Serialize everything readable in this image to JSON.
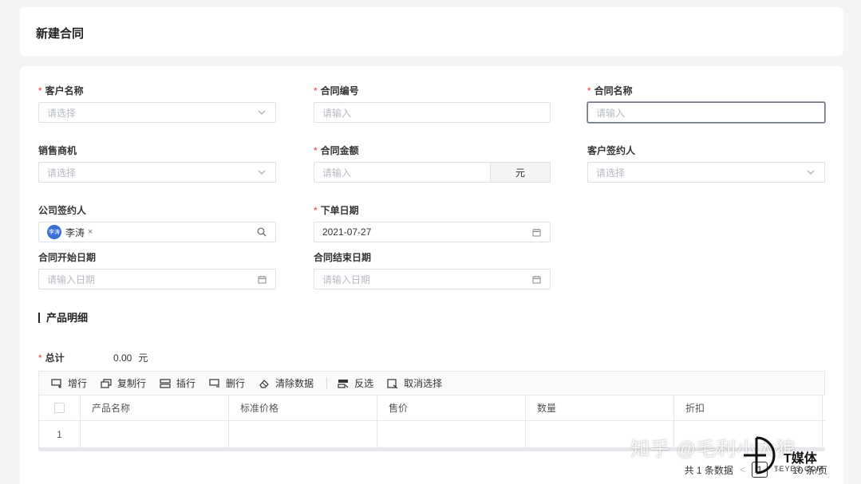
{
  "header": {
    "title": "新建合同"
  },
  "form": {
    "customer_name": {
      "label": "客户名称",
      "required": true,
      "placeholder": "请选择"
    },
    "contract_no": {
      "label": "合同编号",
      "required": true,
      "placeholder": "请输入"
    },
    "contract_name": {
      "label": "合同名称",
      "required": true,
      "placeholder": "请输入"
    },
    "sales_opportunity": {
      "label": "销售商机",
      "required": false,
      "placeholder": "请选择"
    },
    "contract_amount": {
      "label": "合同金额",
      "required": true,
      "placeholder": "请输入",
      "unit": "元"
    },
    "customer_signer": {
      "label": "客户签约人",
      "required": false,
      "placeholder": "请选择"
    },
    "company_signer": {
      "label": "公司签约人",
      "required": false,
      "tag_avatar": "李涛",
      "tag_name": "李涛",
      "tag_close": "×"
    },
    "order_date": {
      "label": "下单日期",
      "required": true,
      "value": "2021-07-27"
    },
    "start_date": {
      "label": "合同开始日期",
      "required": false,
      "placeholder": "请输入日期"
    },
    "end_date": {
      "label": "合同结束日期",
      "required": false,
      "placeholder": "请输入日期"
    },
    "required_mark": "*"
  },
  "products": {
    "section_title": "产品明细",
    "total_label": "总计",
    "total_value": "0.00",
    "total_unit": "元",
    "toolbar": {
      "add_row": "增行",
      "copy_row": "复制行",
      "insert_row": "插行",
      "delete_row": "删行",
      "clear_data": "清除数据",
      "invert_select": "反选",
      "cancel_select": "取消选择"
    },
    "columns": [
      "产品名称",
      "标准价格",
      "售价",
      "数量",
      "折扣"
    ],
    "rows": [
      {
        "index": "1"
      }
    ]
  },
  "pagination": {
    "total_text": "共 1 条数据",
    "prev": "<",
    "current": "1",
    "next": ">",
    "page_size": "10 条/页"
  },
  "watermark": {
    "text": "知乎 @毛利小太狼",
    "logo_text": "T媒体",
    "logo_sub": "TEYES.COM"
  },
  "colors": {
    "required": "#e53935",
    "avatar": "#3b6fd8",
    "border": "#dcdfe6"
  }
}
